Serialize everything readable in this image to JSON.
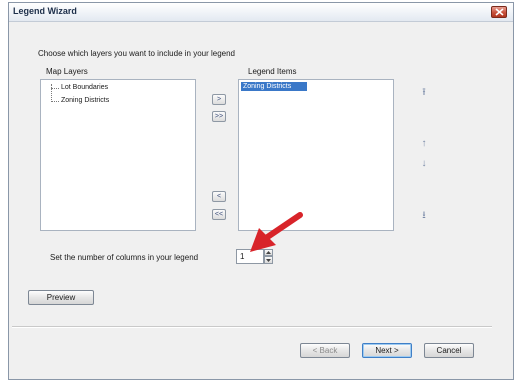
{
  "window": {
    "title": "Legend Wizard"
  },
  "instructions": "Choose which layers you want to include in your legend",
  "map_layers": {
    "label": "Map Layers",
    "items": [
      "Lot Boundaries",
      "Zoning Districts"
    ]
  },
  "legend_items": {
    "label": "Legend Items",
    "items": [
      "Zoning Districts"
    ]
  },
  "transfer_buttons": {
    "add": ">",
    "add_all": ">>",
    "remove": "<",
    "remove_all": "<<"
  },
  "order_buttons": {
    "to_top": "⭱",
    "up": "↑",
    "down": "↓",
    "to_bottom": "⭳"
  },
  "columns": {
    "label": "Set the number of columns in your legend",
    "value": "1"
  },
  "buttons": {
    "preview": "Preview",
    "back": "< Back",
    "next": "Next >",
    "cancel": "Cancel"
  },
  "colors": {
    "annotation_arrow": "#d8242a",
    "selection": "#3a78c8"
  },
  "icons": [
    "close-icon",
    "red-arrow-annotation"
  ]
}
